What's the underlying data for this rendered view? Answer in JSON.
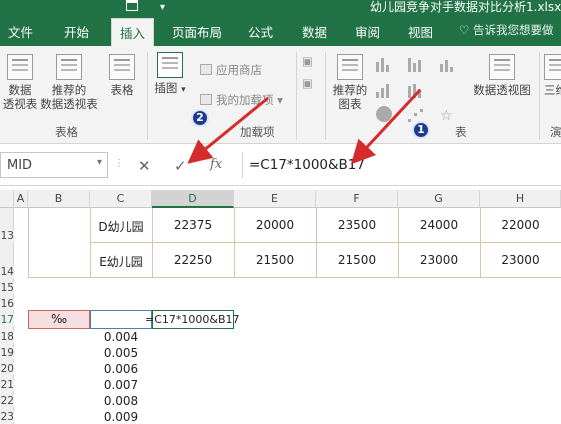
{
  "titlebar": {
    "title": "幼儿园竞争对手数据对比分析1.xlsx"
  },
  "tabs": [
    {
      "label": "文件"
    },
    {
      "label": "开始"
    },
    {
      "label": "插入"
    },
    {
      "label": "页面布局"
    },
    {
      "label": "公式"
    },
    {
      "label": "数据"
    },
    {
      "label": "审阅"
    },
    {
      "label": "视图"
    }
  ],
  "search_hint": "告诉我您想要做",
  "ribbon": {
    "pivot_label_1": "数据",
    "pivot_label_2": "透视表",
    "rec_pivot_label_1": "推荐的",
    "rec_pivot_label_2": "数据透视表",
    "table_label": "表格",
    "group_tables": "表格",
    "illustrations_label": "插图",
    "app_store_label": "应用商店",
    "my_addins_label": "我的加载项",
    "group_addins": "加载项",
    "rec_charts_label_1": "推荐的",
    "rec_charts_label_2": "图表",
    "pivot_chart_label": "数据透视图",
    "threed_label": "三维",
    "group_charts_tail": "表",
    "group_tours_tail": "演"
  },
  "markers": {
    "m1": "1",
    "m2": "2"
  },
  "formula_bar": {
    "name_box": "MID",
    "cancel": "✕",
    "enter": "✓",
    "fx": "fx",
    "formula": "=C17*1000&B17"
  },
  "columns": [
    "A",
    "B",
    "C",
    "D",
    "E",
    "F",
    "G",
    "H"
  ],
  "rows": [
    "13",
    "14",
    "15",
    "16",
    "17",
    "18",
    "19",
    "20",
    "21",
    "22",
    "23"
  ],
  "table": [
    {
      "name": "D幼儿园",
      "values": [
        "22375",
        "20000",
        "23500",
        "24000",
        "22000"
      ]
    },
    {
      "name": "E幼儿园",
      "values": [
        "22250",
        "21500",
        "21500",
        "23000",
        "23000"
      ]
    }
  ],
  "b17": "‰",
  "c17_edit": "=C17*1000&B17",
  "c_values": [
    "0.004",
    "0.005",
    "0.006",
    "0.007",
    "0.008",
    "0.009"
  ]
}
